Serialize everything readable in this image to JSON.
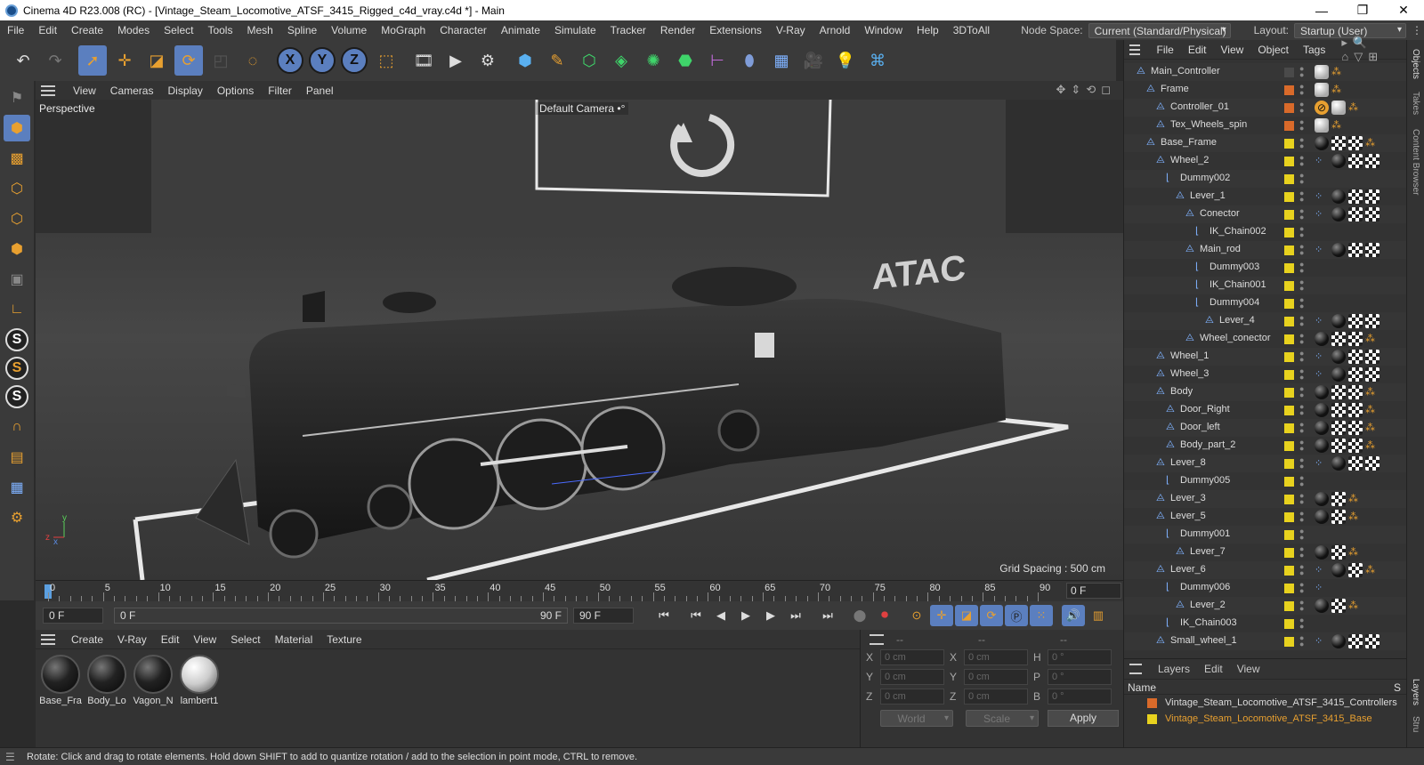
{
  "window": {
    "title": "Cinema 4D R23.008 (RC) - [Vintage_Steam_Locomotive_ATSF_3415_Rigged_c4d_vray.c4d *] - Main",
    "minimize": "—",
    "maximize": "❐",
    "close": "✕"
  },
  "menubar": {
    "items": [
      "File",
      "Edit",
      "Create",
      "Modes",
      "Select",
      "Tools",
      "Mesh",
      "Spline",
      "Volume",
      "MoGraph",
      "Character",
      "Animate",
      "Simulate",
      "Tracker",
      "Render",
      "Extensions",
      "V-Ray",
      "Arnold",
      "Window",
      "Help",
      "3DToAll"
    ],
    "node_space_label": "Node Space:",
    "node_space_value": "Current (Standard/Physical)",
    "layout_label": "Layout:",
    "layout_value": "Startup (User)"
  },
  "viewport_menu": {
    "items": [
      "View",
      "Cameras",
      "Display",
      "Options",
      "Filter",
      "Panel"
    ]
  },
  "viewport": {
    "label": "Perspective",
    "camera_label": "Default Camera",
    "camera_icon": "•°",
    "grid_spacing": "Grid Spacing : 500 cm",
    "axis_x": "x",
    "axis_y": "y",
    "axis_z": "z",
    "tender_text": "ATAC"
  },
  "timeline": {
    "ticks": [
      "0",
      "5",
      "10",
      "15",
      "20",
      "25",
      "30",
      "35",
      "40",
      "45",
      "50",
      "55",
      "60",
      "65",
      "70",
      "75",
      "80",
      "85",
      "90"
    ],
    "current_frame": "0 F"
  },
  "transport": {
    "start_field": "0 F",
    "range_start": "0 F",
    "range_end": "90 F",
    "end_field": "90 F"
  },
  "material_menu": {
    "items": [
      "Create",
      "V-Ray",
      "Edit",
      "View",
      "Select",
      "Material",
      "Texture"
    ]
  },
  "materials": [
    {
      "name": "Base_Fra",
      "color": "dark"
    },
    {
      "name": "Body_Lo",
      "color": "dark"
    },
    {
      "name": "Vagon_N",
      "color": "dark"
    },
    {
      "name": "lambert1",
      "color": "white"
    }
  ],
  "attributes": {
    "header": [
      "--",
      "--",
      "--"
    ],
    "rows": [
      {
        "l1": "X",
        "v1": "0 cm",
        "l2": "X",
        "v2": "0 cm",
        "l3": "H",
        "v3": "0 °"
      },
      {
        "l1": "Y",
        "v1": "0 cm",
        "l2": "Y",
        "v2": "0 cm",
        "l3": "P",
        "v3": "0 °"
      },
      {
        "l1": "Z",
        "v1": "0 cm",
        "l2": "Z",
        "v2": "0 cm",
        "l3": "B",
        "v3": "0 °"
      }
    ],
    "world": "World",
    "scale": "Scale",
    "apply": "Apply"
  },
  "status": {
    "text": "Rotate: Click and drag to rotate elements. Hold down SHIFT to add to quantize rotation / add to the selection in point mode, CTRL to remove."
  },
  "object_menu": {
    "items": [
      "File",
      "Edit",
      "View",
      "Object",
      "Tags"
    ]
  },
  "objects": [
    {
      "name": "Main_Controller",
      "depth": 0,
      "icon": "null",
      "layer": "#4a4a4a",
      "tags": [
        "white",
        "dot"
      ]
    },
    {
      "name": "Frame",
      "depth": 1,
      "icon": "null",
      "layer": "#d96a2a",
      "tags": [
        "white",
        "dot"
      ]
    },
    {
      "name": "Controller_01",
      "depth": 2,
      "icon": "null",
      "layer": "#d96a2a",
      "tags": [
        "no",
        "white",
        "dot"
      ]
    },
    {
      "name": "Tex_Wheels_spin",
      "depth": 2,
      "icon": "null",
      "layer": "#d96a2a",
      "tags": [
        "white",
        "dot"
      ]
    },
    {
      "name": "Base_Frame",
      "depth": 1,
      "icon": "null",
      "layer": "#e8d21e",
      "tags": [
        "black",
        "chk",
        "chk",
        "dot"
      ]
    },
    {
      "name": "Wheel_2",
      "depth": 2,
      "icon": "null",
      "layer": "#e8d21e",
      "tags": [
        "ik",
        "black",
        "chk",
        "chk"
      ]
    },
    {
      "name": "Dummy002",
      "depth": 3,
      "icon": "bone",
      "layer": "#e8d21e",
      "tags": []
    },
    {
      "name": "Lever_1",
      "depth": 4,
      "icon": "null",
      "layer": "#e8d21e",
      "tags": [
        "ik",
        "black",
        "chk",
        "chk"
      ]
    },
    {
      "name": "Conector",
      "depth": 5,
      "icon": "null",
      "layer": "#e8d21e",
      "tags": [
        "ik",
        "black",
        "chk",
        "chk"
      ]
    },
    {
      "name": "IK_Chain002",
      "depth": 6,
      "icon": "bone",
      "layer": "#e8d21e",
      "tags": []
    },
    {
      "name": "Main_rod",
      "depth": 5,
      "icon": "null",
      "layer": "#e8d21e",
      "tags": [
        "ik",
        "black",
        "chk",
        "chk"
      ]
    },
    {
      "name": "Dummy003",
      "depth": 6,
      "icon": "bone",
      "layer": "#e8d21e",
      "tags": []
    },
    {
      "name": "IK_Chain001",
      "depth": 6,
      "icon": "bone",
      "layer": "#e8d21e",
      "tags": []
    },
    {
      "name": "Dummy004",
      "depth": 6,
      "icon": "bone",
      "layer": "#e8d21e",
      "tags": []
    },
    {
      "name": "Lever_4",
      "depth": 7,
      "icon": "null",
      "layer": "#e8d21e",
      "tags": [
        "ik",
        "black",
        "chk",
        "chk"
      ]
    },
    {
      "name": "Wheel_conector",
      "depth": 5,
      "icon": "null",
      "layer": "#e8d21e",
      "tags": [
        "black",
        "chk",
        "chk",
        "dot"
      ]
    },
    {
      "name": "Wheel_1",
      "depth": 2,
      "icon": "null",
      "layer": "#e8d21e",
      "tags": [
        "ik",
        "black",
        "chk",
        "chk"
      ]
    },
    {
      "name": "Wheel_3",
      "depth": 2,
      "icon": "null",
      "layer": "#e8d21e",
      "tags": [
        "ik",
        "black",
        "chk",
        "chk"
      ]
    },
    {
      "name": "Body",
      "depth": 2,
      "icon": "null",
      "layer": "#e8d21e",
      "tags": [
        "black",
        "chk",
        "chk",
        "dot"
      ]
    },
    {
      "name": "Door_Right",
      "depth": 3,
      "icon": "null",
      "layer": "#e8d21e",
      "tags": [
        "black",
        "chk",
        "chk",
        "dot"
      ]
    },
    {
      "name": "Door_left",
      "depth": 3,
      "icon": "null",
      "layer": "#e8d21e",
      "tags": [
        "black",
        "chk",
        "chk",
        "dot"
      ]
    },
    {
      "name": "Body_part_2",
      "depth": 3,
      "icon": "null",
      "layer": "#e8d21e",
      "tags": [
        "black",
        "chk",
        "chk",
        "dot"
      ]
    },
    {
      "name": "Lever_8",
      "depth": 2,
      "icon": "null",
      "layer": "#e8d21e",
      "tags": [
        "ik",
        "black",
        "chk",
        "chk"
      ]
    },
    {
      "name": "Dummy005",
      "depth": 3,
      "icon": "bone",
      "layer": "#e8d21e",
      "tags": []
    },
    {
      "name": "Lever_3",
      "depth": 2,
      "icon": "null",
      "layer": "#e8d21e",
      "tags": [
        "black",
        "chk",
        "dot"
      ]
    },
    {
      "name": "Lever_5",
      "depth": 2,
      "icon": "null",
      "layer": "#e8d21e",
      "tags": [
        "black",
        "chk",
        "dot"
      ]
    },
    {
      "name": "Dummy001",
      "depth": 3,
      "icon": "bone",
      "layer": "#e8d21e",
      "tags": []
    },
    {
      "name": "Lever_7",
      "depth": 4,
      "icon": "null",
      "layer": "#e8d21e",
      "tags": [
        "black",
        "chk",
        "dot"
      ]
    },
    {
      "name": "Lever_6",
      "depth": 2,
      "icon": "null",
      "layer": "#e8d21e",
      "tags": [
        "ik",
        "black",
        "chk",
        "dot"
      ]
    },
    {
      "name": "Dummy006",
      "depth": 3,
      "icon": "bone",
      "layer": "#e8d21e",
      "tags": [
        "ik"
      ]
    },
    {
      "name": "Lever_2",
      "depth": 4,
      "icon": "null",
      "layer": "#e8d21e",
      "tags": [
        "black",
        "chk",
        "dot"
      ]
    },
    {
      "name": "IK_Chain003",
      "depth": 3,
      "icon": "bone",
      "layer": "#e8d21e",
      "tags": []
    },
    {
      "name": "Small_wheel_1",
      "depth": 2,
      "icon": "null",
      "layer": "#e8d21e",
      "tags": [
        "ik",
        "black",
        "chk",
        "chk"
      ]
    }
  ],
  "layers_menu": {
    "items": [
      "Layers",
      "Edit",
      "View"
    ],
    "column": "Name",
    "column_s": "S"
  },
  "layers": [
    {
      "name": "Vintage_Steam_Locomotive_ATSF_3415_Controllers",
      "color": "#d96a2a",
      "text_color": "#dddddd"
    },
    {
      "name": "Vintage_Steam_Locomotive_ATSF_3415_Base",
      "color": "#e8d21e",
      "text_color": "#e8a030"
    }
  ],
  "side_tabs": [
    "Objects",
    "Takes",
    "Content Browser",
    "Layers",
    "Stru"
  ],
  "icons": {
    "undo": "undo-icon",
    "redo": "redo-icon",
    "select": "cursor-icon",
    "move": "move-icon",
    "scale": "scale-icon",
    "rotate": "rotate-icon"
  },
  "colors": {
    "accent": "#5b7fbf",
    "orange": "#e8a030",
    "yellow_layer": "#e8d21e",
    "orange_layer": "#d96a2a"
  }
}
